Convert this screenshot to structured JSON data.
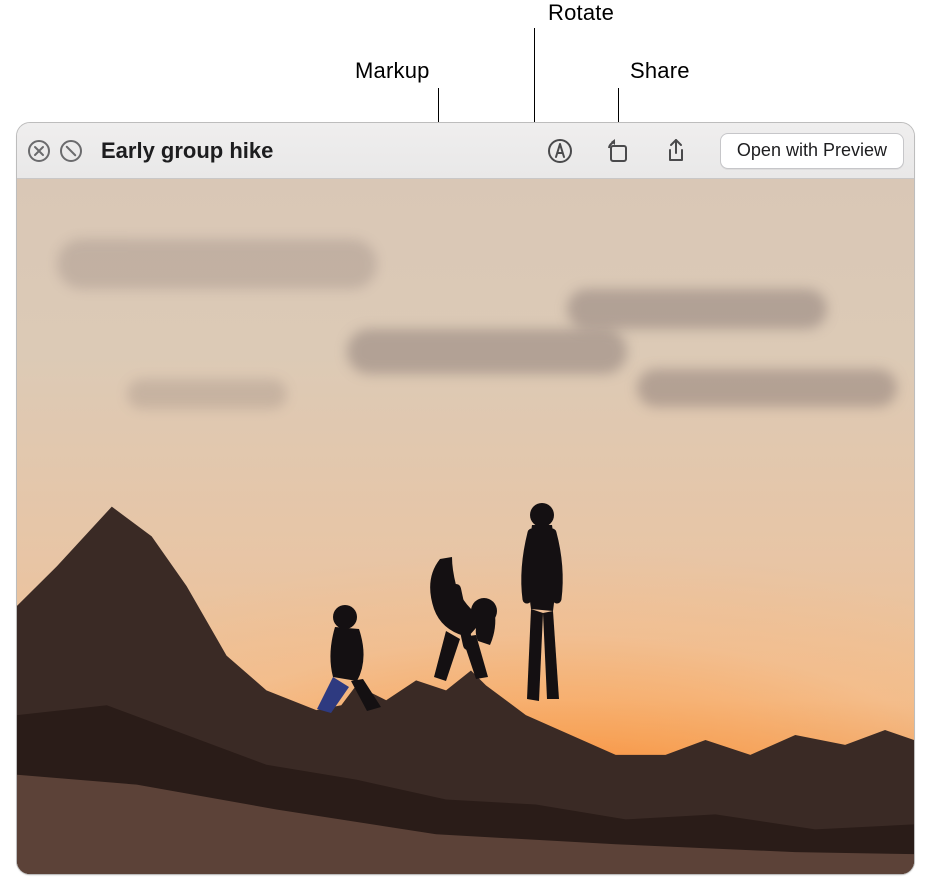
{
  "callouts": {
    "markup": "Markup",
    "rotate": "Rotate",
    "share": "Share"
  },
  "toolbar": {
    "title": "Early group hike",
    "open_button": "Open with Preview",
    "icons": {
      "close": "close-icon",
      "fullscreen": "fullscreen-icon",
      "markup": "markup-icon",
      "rotate": "rotate-icon",
      "share": "share-icon"
    }
  }
}
